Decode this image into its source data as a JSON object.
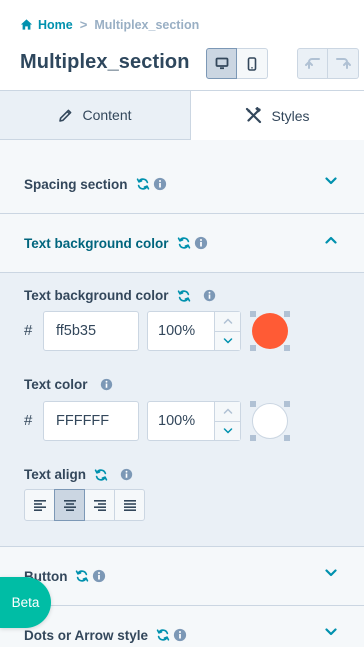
{
  "breadcrumb": {
    "home": "Home",
    "separator": ">",
    "current": "Multiplex_section"
  },
  "page_title": "Multiplex_section",
  "view_toggle": {
    "selected": "desktop",
    "options": [
      "desktop-icon",
      "mobile-icon"
    ]
  },
  "history": {
    "undo_icon": "undo-icon",
    "redo_icon": "redo-icon"
  },
  "tabs": [
    {
      "label": "Content",
      "icon": "pencil-icon",
      "active": false
    },
    {
      "label": "Styles",
      "icon": "brush-ruler-icon",
      "active": true
    }
  ],
  "sections": {
    "spacing": {
      "label": "Spacing section",
      "expanded": false
    },
    "text_bg": {
      "label": "Text background color",
      "expanded": true
    },
    "button": {
      "label": "Button",
      "expanded": false
    },
    "dots": {
      "label": "Dots or Arrow style",
      "expanded": false
    }
  },
  "fields": {
    "bg_color": {
      "label": "Text background color",
      "hash": "#",
      "hex": "ff5b35",
      "opacity": "100%",
      "swatch": "#ff5b35"
    },
    "text_color": {
      "label": "Text color",
      "hash": "#",
      "hex": "FFFFFF",
      "opacity": "100%",
      "swatch": "#ffffff"
    },
    "text_align": {
      "label": "Text align",
      "options": [
        "align-left-icon",
        "align-center-icon",
        "align-right-icon",
        "align-justify-icon"
      ],
      "selected": "align-center-icon"
    }
  },
  "beta_label": "Beta",
  "colors": {
    "accent": "#0091ae",
    "open_title": "#00657d",
    "beta": "#00bda5",
    "panel": "#eaf0f6"
  }
}
